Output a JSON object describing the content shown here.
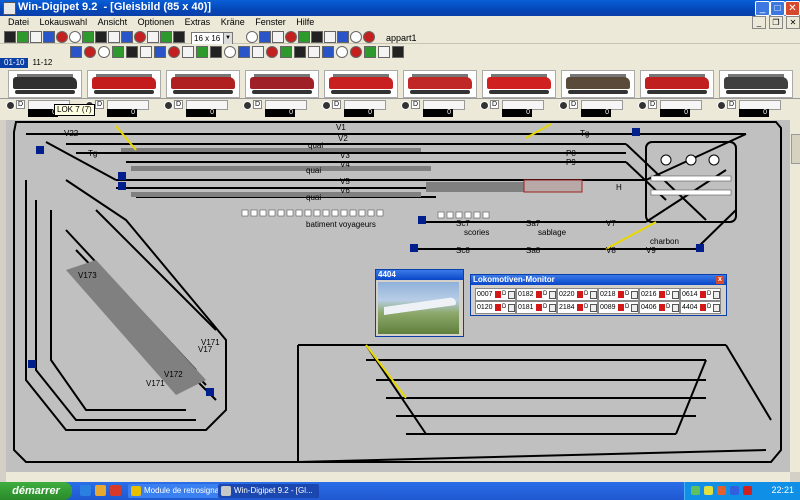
{
  "window": {
    "title": "Win-Digipet 9.2  - [Gleisbild (85 x 40)]",
    "minimize": "_",
    "maximize": "□",
    "close": "✕"
  },
  "menu": {
    "items": [
      "Datei",
      "Lokauswahl",
      "Ansicht",
      "Optionen",
      "Extras",
      "Kräne",
      "Fenster",
      "Hilfe"
    ],
    "doc_buttons": [
      "_",
      "❐",
      "✕"
    ]
  },
  "toolbar": {
    "zoom": "16 x 16",
    "appart": "appart1"
  },
  "loco_tabs": [
    "01-10",
    "11-12"
  ],
  "loco_strip": {
    "tooltip": "LOK 7 (7)",
    "locos": [
      {
        "color": "#303030"
      },
      {
        "color": "#c41c1c"
      },
      {
        "color": "#b02020"
      },
      {
        "color": "#a02028"
      },
      {
        "color": "#c82020"
      },
      {
        "color": "#c02828"
      },
      {
        "color": "#d02020"
      },
      {
        "color": "#5a4a3a"
      },
      {
        "color": "#c02020"
      },
      {
        "color": "#404040"
      }
    ],
    "control_labels": [
      "D",
      "D",
      "D",
      "D",
      "D",
      "D",
      "D",
      "D",
      "D",
      "D"
    ],
    "speeds": [
      "0",
      "0",
      "0",
      "0",
      "0",
      "0",
      "0",
      "0",
      "0",
      "0"
    ]
  },
  "track": {
    "labels": {
      "v22": "V22",
      "v1": "V1",
      "v2": "V2",
      "v3": "V3",
      "v4": "V4",
      "v5": "V5",
      "v6": "V6",
      "v7": "V7",
      "v8": "V8",
      "v9": "V9",
      "v171a": "V171",
      "v171b": "V171",
      "v172": "V172",
      "v173": "V173",
      "v17x": "V17",
      "quai1": "quai",
      "quai2": "quai",
      "quai3": "quai",
      "batiment": "batiment  voyageurs",
      "scories": "scories",
      "sablage": "sablage",
      "charbon": "charbon",
      "sc7": "Sc7",
      "sa7": "Sa7",
      "sc8": "Sc8",
      "sa8": "Sa8",
      "tg": "Tg",
      "p8": "P8",
      "p9": "P9",
      "h": "H"
    }
  },
  "loco_popup": {
    "title": "4404"
  },
  "monitor": {
    "title": "Lokomotiven-Monitor",
    "close": "x",
    "cells": [
      {
        "num": "0007",
        "d": "D"
      },
      {
        "num": "0182",
        "d": "D"
      },
      {
        "num": "0220",
        "d": "D"
      },
      {
        "num": "0218",
        "d": "D"
      },
      {
        "num": "0216",
        "d": "D"
      },
      {
        "num": "0614",
        "d": "D"
      },
      {
        "num": "0120",
        "d": "D"
      },
      {
        "num": "0181",
        "d": "D"
      },
      {
        "num": "2184",
        "d": "D"
      },
      {
        "num": "0089",
        "d": "D"
      },
      {
        "num": "0406",
        "d": "D"
      },
      {
        "num": "4404",
        "d": "D"
      }
    ]
  },
  "taskbar": {
    "start": "démarrer",
    "tasks": [
      {
        "label": "Module de retrosignal...",
        "active": false
      },
      {
        "label": "Win-Digipet 9.2 - [Gl...",
        "active": true
      }
    ],
    "clock": "22:21"
  }
}
